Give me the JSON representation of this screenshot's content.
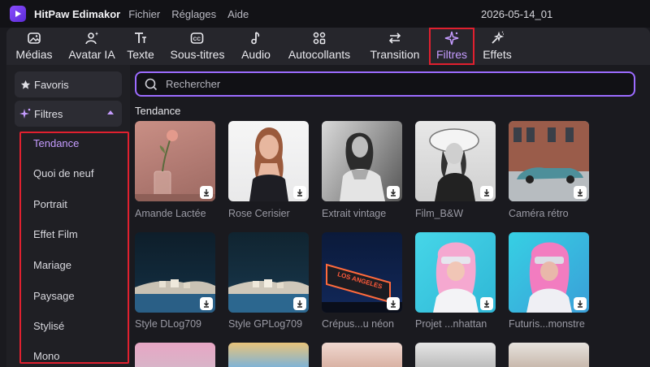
{
  "app": {
    "name": "HitPaw Edimakor",
    "project": "2026-05-14_01"
  },
  "menu": [
    "Fichier",
    "Réglages",
    "Aide"
  ],
  "toolbar": [
    {
      "label": "Médias",
      "icon": "media-icon"
    },
    {
      "label": "Avatar IA",
      "icon": "avatar-ai-icon"
    },
    {
      "label": "Texte",
      "icon": "text-icon"
    },
    {
      "label": "Sous-titres",
      "icon": "subtitles-icon"
    },
    {
      "label": "Audio",
      "icon": "audio-icon"
    },
    {
      "label": "Autocollants",
      "icon": "stickers-icon"
    },
    {
      "label": "Transition",
      "icon": "transition-icon"
    },
    {
      "label": "Filtres",
      "icon": "filters-icon",
      "active": true
    },
    {
      "label": "Effets",
      "icon": "effects-icon"
    }
  ],
  "sidebar": {
    "favoris": "Favoris",
    "filtres": "Filtres",
    "items": [
      "Tendance",
      "Quoi de neuf",
      "Portrait",
      "Effet Film",
      "Mariage",
      "Paysage",
      "Stylisé",
      "Mono"
    ],
    "active": "Tendance"
  },
  "search": {
    "placeholder": "Rechercher"
  },
  "section": {
    "title": "Tendance"
  },
  "filters": [
    {
      "label": "Amande Lactée"
    },
    {
      "label": "Rose Cerisier"
    },
    {
      "label": "Extrait vintage"
    },
    {
      "label": "Film_B&W"
    },
    {
      "label": "Caméra rétro"
    },
    {
      "label": "Style DLog709"
    },
    {
      "label": "Style GPLog709"
    },
    {
      "label": "Crépus...u néon"
    },
    {
      "label": "Projet ...nhattan"
    },
    {
      "label": "Futuris...monstre"
    }
  ],
  "colors": {
    "accent": "#c59cff",
    "highlight": "#e0202f"
  }
}
